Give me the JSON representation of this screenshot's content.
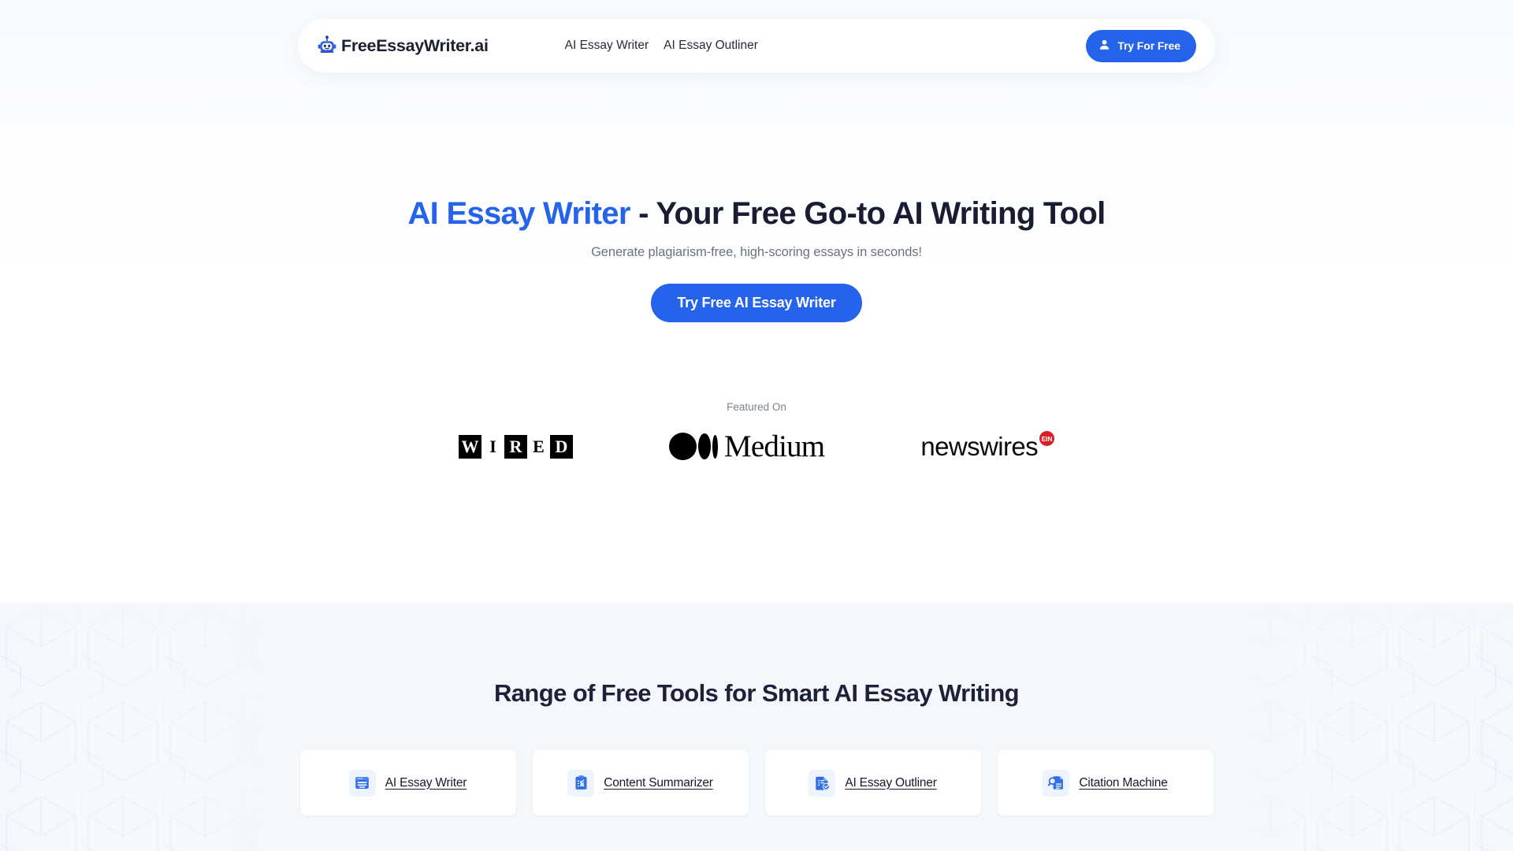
{
  "brand": {
    "name": "FreeEssayWriter.ai",
    "icon": "robot-icon"
  },
  "header": {
    "nav": [
      {
        "label": "AI Essay Writer"
      },
      {
        "label": "AI Essay Outliner"
      }
    ],
    "cta": {
      "label": "Try For Free",
      "icon": "user-icon"
    }
  },
  "hero": {
    "title_accent": "AI Essay Writer",
    "title_rest": " - Your Free Go-to AI Writing Tool",
    "subtitle": "Generate plagiarism-free, high-scoring essays in seconds!",
    "cta_label": "Try Free AI Essay Writer"
  },
  "featured": {
    "label": "Featured On",
    "logos": [
      {
        "name": "wired-logo",
        "text": "WIRED"
      },
      {
        "name": "medium-logo",
        "text": "Medium"
      },
      {
        "name": "newswires-logo",
        "text": "newswires",
        "badge": "EIN"
      }
    ]
  },
  "tools": {
    "title": "Range of Free Tools for Smart AI Essay Writing",
    "cards": [
      {
        "label": "AI Essay Writer",
        "icon": "document-window-icon"
      },
      {
        "label": "Content Summarizer",
        "icon": "clipboard-checklist-icon"
      },
      {
        "label": "AI Essay Outliner",
        "icon": "document-check-icon"
      },
      {
        "label": "Citation Machine",
        "icon": "document-search-icon"
      }
    ]
  },
  "colors": {
    "accent": "#2563eb",
    "heading": "#191d31",
    "muted": "#6c7180",
    "section_bg": "#f4f8fc",
    "icon_bg": "#eef4fe",
    "badge_red": "#d81f26"
  }
}
